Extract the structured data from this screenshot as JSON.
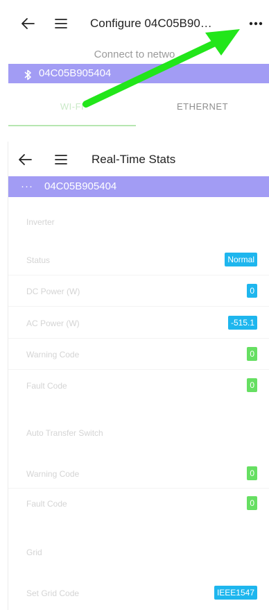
{
  "screen1": {
    "title": "Configure 04C05B90…",
    "subtitle": "Connect to netwo",
    "device_id": "04C05B905404",
    "tabs": [
      {
        "label": "WI-FI"
      },
      {
        "label": "ETHERNET"
      }
    ],
    "icons": {
      "back": "arrow-left-icon",
      "menu": "hamburger-icon",
      "more": "more-icon",
      "bluetooth": "bluetooth-icon"
    }
  },
  "screen2": {
    "title": "Real-Time Stats",
    "device_id": "04C05B905404",
    "device_prefix": "···",
    "sections": {
      "inverter": {
        "label": "Inverter",
        "rows": [
          {
            "label": "Status",
            "value": "Normal"
          },
          {
            "label": "DC Power (W)",
            "value": "0"
          },
          {
            "label": "AC Power (W)",
            "value": "-515.1"
          },
          {
            "label": "Warning Code",
            "value": "0"
          },
          {
            "label": "Fault Code",
            "value": "0"
          }
        ]
      },
      "ats": {
        "label": "Auto Transfer Switch",
        "rows": [
          {
            "label": "Warning Code",
            "value": "0"
          },
          {
            "label": "Fault Code",
            "value": "0"
          }
        ]
      },
      "grid": {
        "label": "Grid",
        "rows": [
          {
            "label": "Set Grid Code",
            "value": "IEEE1547"
          }
        ]
      }
    }
  },
  "colors": {
    "accent_purple": "#a29cf4",
    "badge_blue": "#1eb6ee",
    "badge_green": "#66df62",
    "arrow_green": "#22e61a"
  }
}
